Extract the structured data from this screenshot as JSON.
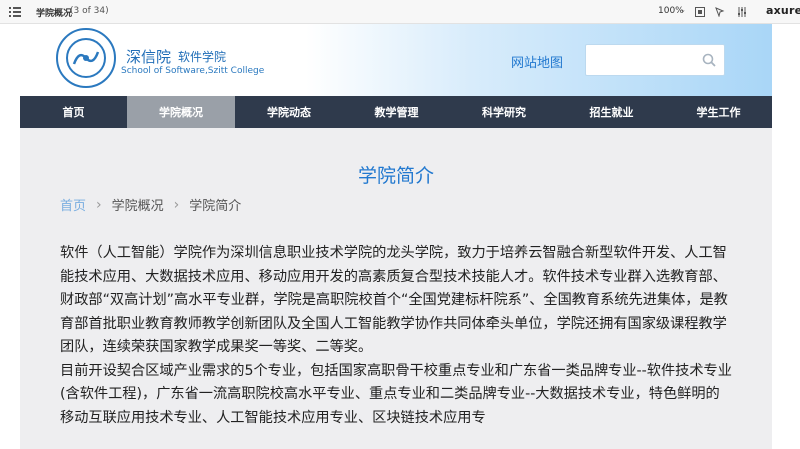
{
  "viewer": {
    "page_title": "学院概况",
    "page_count": "(3 of 34)",
    "zoom": "100%",
    "logo": "axure"
  },
  "header": {
    "school_name": "深信院",
    "school_sub": "软件学院",
    "school_en": "School of Software,Szitt College",
    "sitemap": "网站地图",
    "search_placeholder": ""
  },
  "nav": {
    "items": [
      {
        "label": "首页"
      },
      {
        "label": "学院概况"
      },
      {
        "label": "学院动态"
      },
      {
        "label": "教学管理"
      },
      {
        "label": "科学研究"
      },
      {
        "label": "招生就业"
      },
      {
        "label": "学生工作"
      }
    ],
    "active_index": 1
  },
  "content": {
    "title": "学院简介",
    "breadcrumb": [
      "首页",
      "学院概况",
      "学院简介"
    ],
    "paragraphs": [
      "软件（人工智能）学院作为深圳信息职业技术学院的龙头学院，致力于培养云智融合新型软件开发、人工智能技术应用、大数据技术应用、移动应用开发的高素质复合型技术技能人才。软件技术专业群入选教育部、财政部“双高计划”高水平专业群，学院是高职院校首个“全国党建标杆院系”、全国教育系统先进集体，是教育部首批职业教育教师教学创新团队及全国人工智能教学协作共同体牵头单位，学院还拥有国家级课程教学团队，连续荣获国家教学成果奖一等奖、二等奖。",
      "目前开设契合区域产业需求的5个专业，包括国家高职骨干校重点专业和广东省一类品牌专业--软件技术专业(含软件工程)，广东省一流高职院校高水平专业、重点专业和二类品牌专业--大数据技术专业，特色鲜明的移动互联应用技术专业、人工智能技术应用专业、区块链技术应用专"
    ]
  }
}
